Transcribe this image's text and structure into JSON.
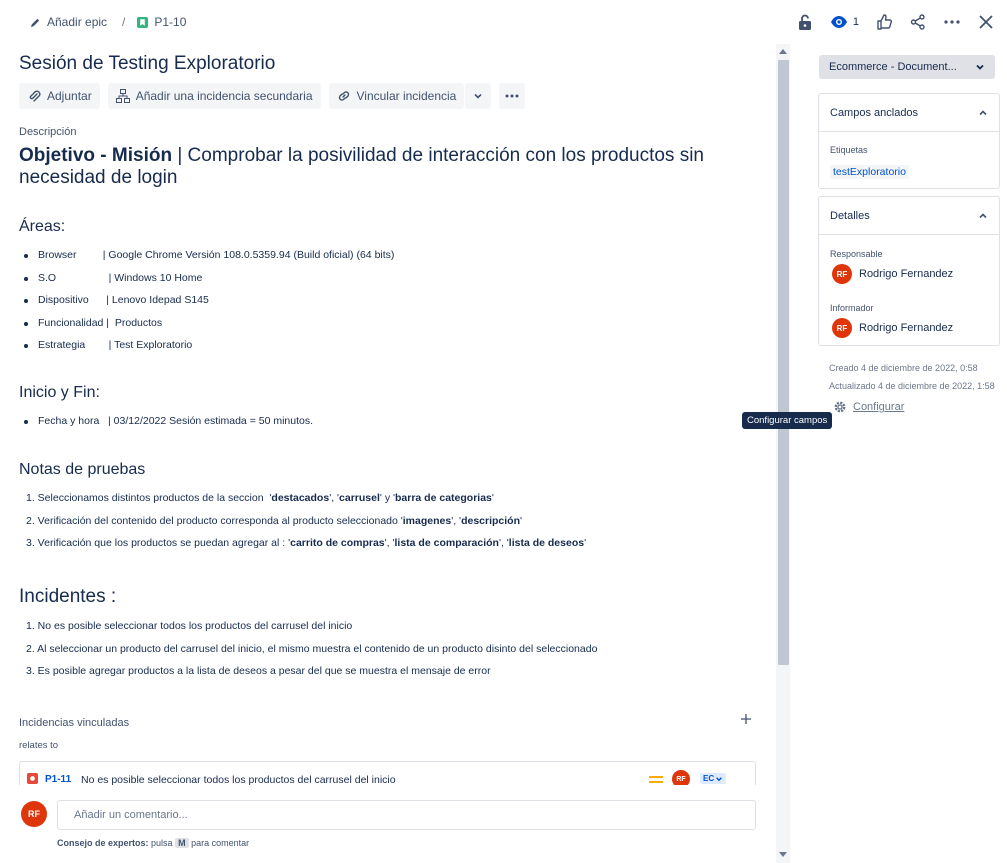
{
  "breadcrumb": {
    "add_epic": "Añadir epic",
    "separator": "/",
    "issue_key": "P1-10"
  },
  "topbar": {
    "watch_count": "1"
  },
  "issue": {
    "title": "Sesión de Testing Exploratorio"
  },
  "actions": {
    "attach": "Adjuntar",
    "add_child": "Añadir una incidencia secundaria",
    "link_issue": "Vincular incidencia"
  },
  "description": {
    "label": "Descripción",
    "objective_bold": "Objetivo - Misión",
    "objective_rest": " | Comprobar la posivilidad de interacción con los productos sin necesidad de login",
    "areas_heading": "Áreas:",
    "areas": [
      "Browser         | Google Chrome Versión 108.0.5359.94 (Build oficial) (64 bits)",
      "S.O                  | Windows 10 Home",
      "Dispositivo      | Lenovo Idepad S145",
      "Funcionalidad |  Productos",
      "Estrategia        | Test Exploratorio"
    ],
    "timing_heading": "Inicio y Fin:",
    "timing": [
      "Fecha y hora   | 03/12/2022 Sesión estimada = 50 minutos."
    ],
    "notes_heading": "Notas de pruebas",
    "notes": [
      {
        "n": "1.",
        "segments": [
          {
            "t": " Seleccionamos distintos productos de la seccion  '",
            "b": false
          },
          {
            "t": "destacados",
            "b": true
          },
          {
            "t": "', '",
            "b": false
          },
          {
            "t": "carrusel",
            "b": true
          },
          {
            "t": "' y '",
            "b": false
          },
          {
            "t": "barra de categorias",
            "b": true
          },
          {
            "t": "'",
            "b": false
          }
        ]
      },
      {
        "n": "2.",
        "segments": [
          {
            "t": " Verificación del contenido del producto corresponda al producto seleccionado '",
            "b": false
          },
          {
            "t": "imagenes",
            "b": true
          },
          {
            "t": "', '",
            "b": false
          },
          {
            "t": "descripción",
            "b": true
          },
          {
            "t": "'",
            "b": false
          }
        ]
      },
      {
        "n": "3.",
        "segments": [
          {
            "t": " Verificación que los productos se puedan agregar al : '",
            "b": false
          },
          {
            "t": "carrito de compras",
            "b": true
          },
          {
            "t": "', '",
            "b": false
          },
          {
            "t": "lista de comparación",
            "b": true
          },
          {
            "t": "', '",
            "b": false
          },
          {
            "t": "lista de deseos",
            "b": true
          },
          {
            "t": "'",
            "b": false
          }
        ]
      }
    ],
    "incidents_heading": "Incidentes :",
    "incidents": [
      "1. No es posible seleccionar todos los productos del carrusel del inicio",
      "2. Al seleccionar un producto del carrusel del inicio, el mismo muestra el contenido de un producto disinto del seleccionado",
      "3. Es posible agregar productos a la lista de deseos a pesar del que se muestra el mensaje de error"
    ]
  },
  "linked": {
    "heading": "Incidencias vinculadas",
    "relation": "relates to",
    "items": [
      {
        "key": "P1-11",
        "summary": "No es posible seleccionar todos los productos del carrusel del inicio",
        "assignee_initials": "RF",
        "status": "EC"
      }
    ]
  },
  "comment": {
    "avatar_initials": "RF",
    "placeholder": "Añadir un comentario...",
    "tip_bold": "Consejo de expertos:",
    "tip_pre": " pulsa ",
    "tip_key": "M",
    "tip_post": " para comentar"
  },
  "sidebar": {
    "status_button": "Ecommerce - Document...",
    "pinned": {
      "heading": "Campos anclados",
      "labels_title": "Etiquetas",
      "label_value": "testExploratorio"
    },
    "details": {
      "heading": "Detalles",
      "assignee_label": "Responsable",
      "assignee_name": "Rodrigo Fernandez",
      "assignee_initials": "RF",
      "reporter_label": "Informador",
      "reporter_name": "Rodrigo Fernandez",
      "reporter_initials": "RF"
    },
    "created": "Creado 4 de diciembre de 2022, 0:58",
    "updated": "Actualizado 4 de diciembre de 2022, 1:58",
    "configure": "Configurar",
    "tooltip": "Configurar campos"
  },
  "colors": {
    "accent": "#0052cc",
    "avatar": "#de350b",
    "epic_green": "#36b37e",
    "priority": "#ffab00",
    "bug_red": "#e5493a"
  }
}
